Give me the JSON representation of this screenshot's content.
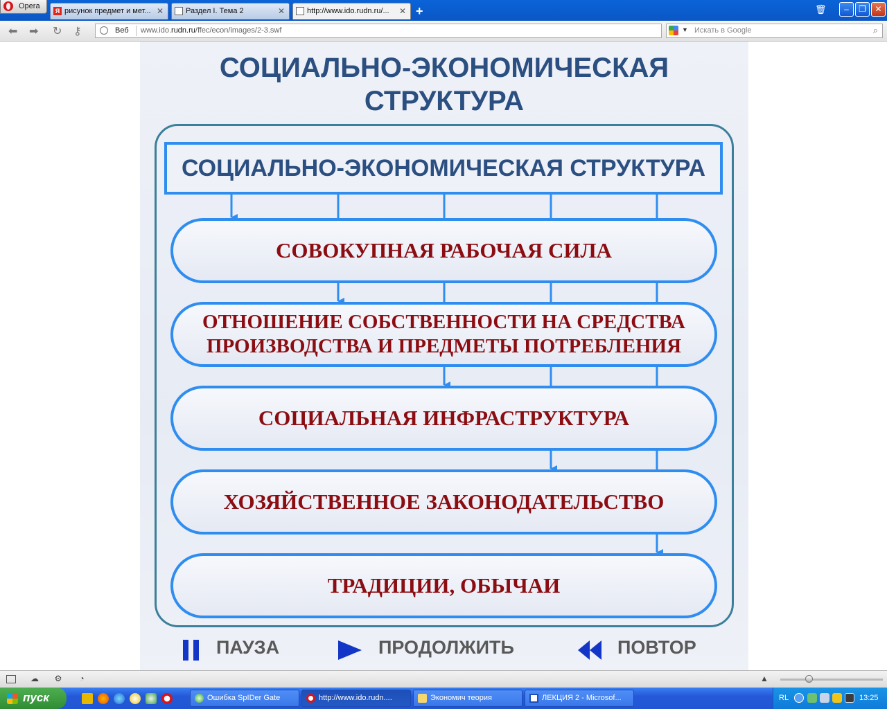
{
  "browser": {
    "menu_label": "Opera",
    "tabs": [
      {
        "label": "рисунок предмет и мет..."
      },
      {
        "label": "Раздел I. Тема 2"
      },
      {
        "label": "http://www.ido.rudn.ru/..."
      }
    ],
    "address": {
      "web_label": "Веб",
      "url_host": "www.ido.",
      "url_domain": "rudn.ru",
      "url_path": "/ffec/econ/images/2-3.swf"
    },
    "search_placeholder": "Искать в Google"
  },
  "slide": {
    "title_line1": "СОЦИАЛЬНО-ЭКОНОМИЧЕСКАЯ",
    "title_line2": "СТРУКТУРА",
    "header_box": "СОЦИАЛЬНО-ЭКОНОМИЧЕСКАЯ СТРУКТУРА",
    "items": [
      {
        "line1": "СОВОКУПНАЯ РАБОЧАЯ СИЛА",
        "line2": ""
      },
      {
        "line1": "ОТНОШЕНИЕ СОБСТВЕННОСТИ НА СРЕДСТВА",
        "line2": "ПРОИЗВОДСТВА И ПРЕДМЕТЫ ПОТРЕБЛЕНИЯ"
      },
      {
        "line1": "СОЦИАЛЬНАЯ ИНФРАСТРУКТУРА",
        "line2": ""
      },
      {
        "line1": "ХОЗЯЙСТВЕННОЕ ЗАКОНОДАТЕЛЬСТВО",
        "line2": ""
      },
      {
        "line1": "ТРАДИЦИИ, ОБЫЧАИ",
        "line2": ""
      }
    ],
    "controls": {
      "pause": "ПАУЗА",
      "continue": "ПРОДОЛЖИТЬ",
      "repeat": "ПОВТОР"
    },
    "colors": {
      "title": "#2b4f80",
      "item_text": "#8b0d12",
      "outline": "#2f8df0",
      "control_icon": "#1436c7"
    }
  },
  "taskbar": {
    "start_label": "пуск",
    "tasks": [
      {
        "label": "Ошибка SpIDer Gate"
      },
      {
        "label": "http://www.ido.rudn...."
      },
      {
        "label": "Экономич теория"
      },
      {
        "label": "ЛЕКЦИЯ 2 - Microsof..."
      }
    ],
    "lang": "RL",
    "time": "13:25"
  }
}
